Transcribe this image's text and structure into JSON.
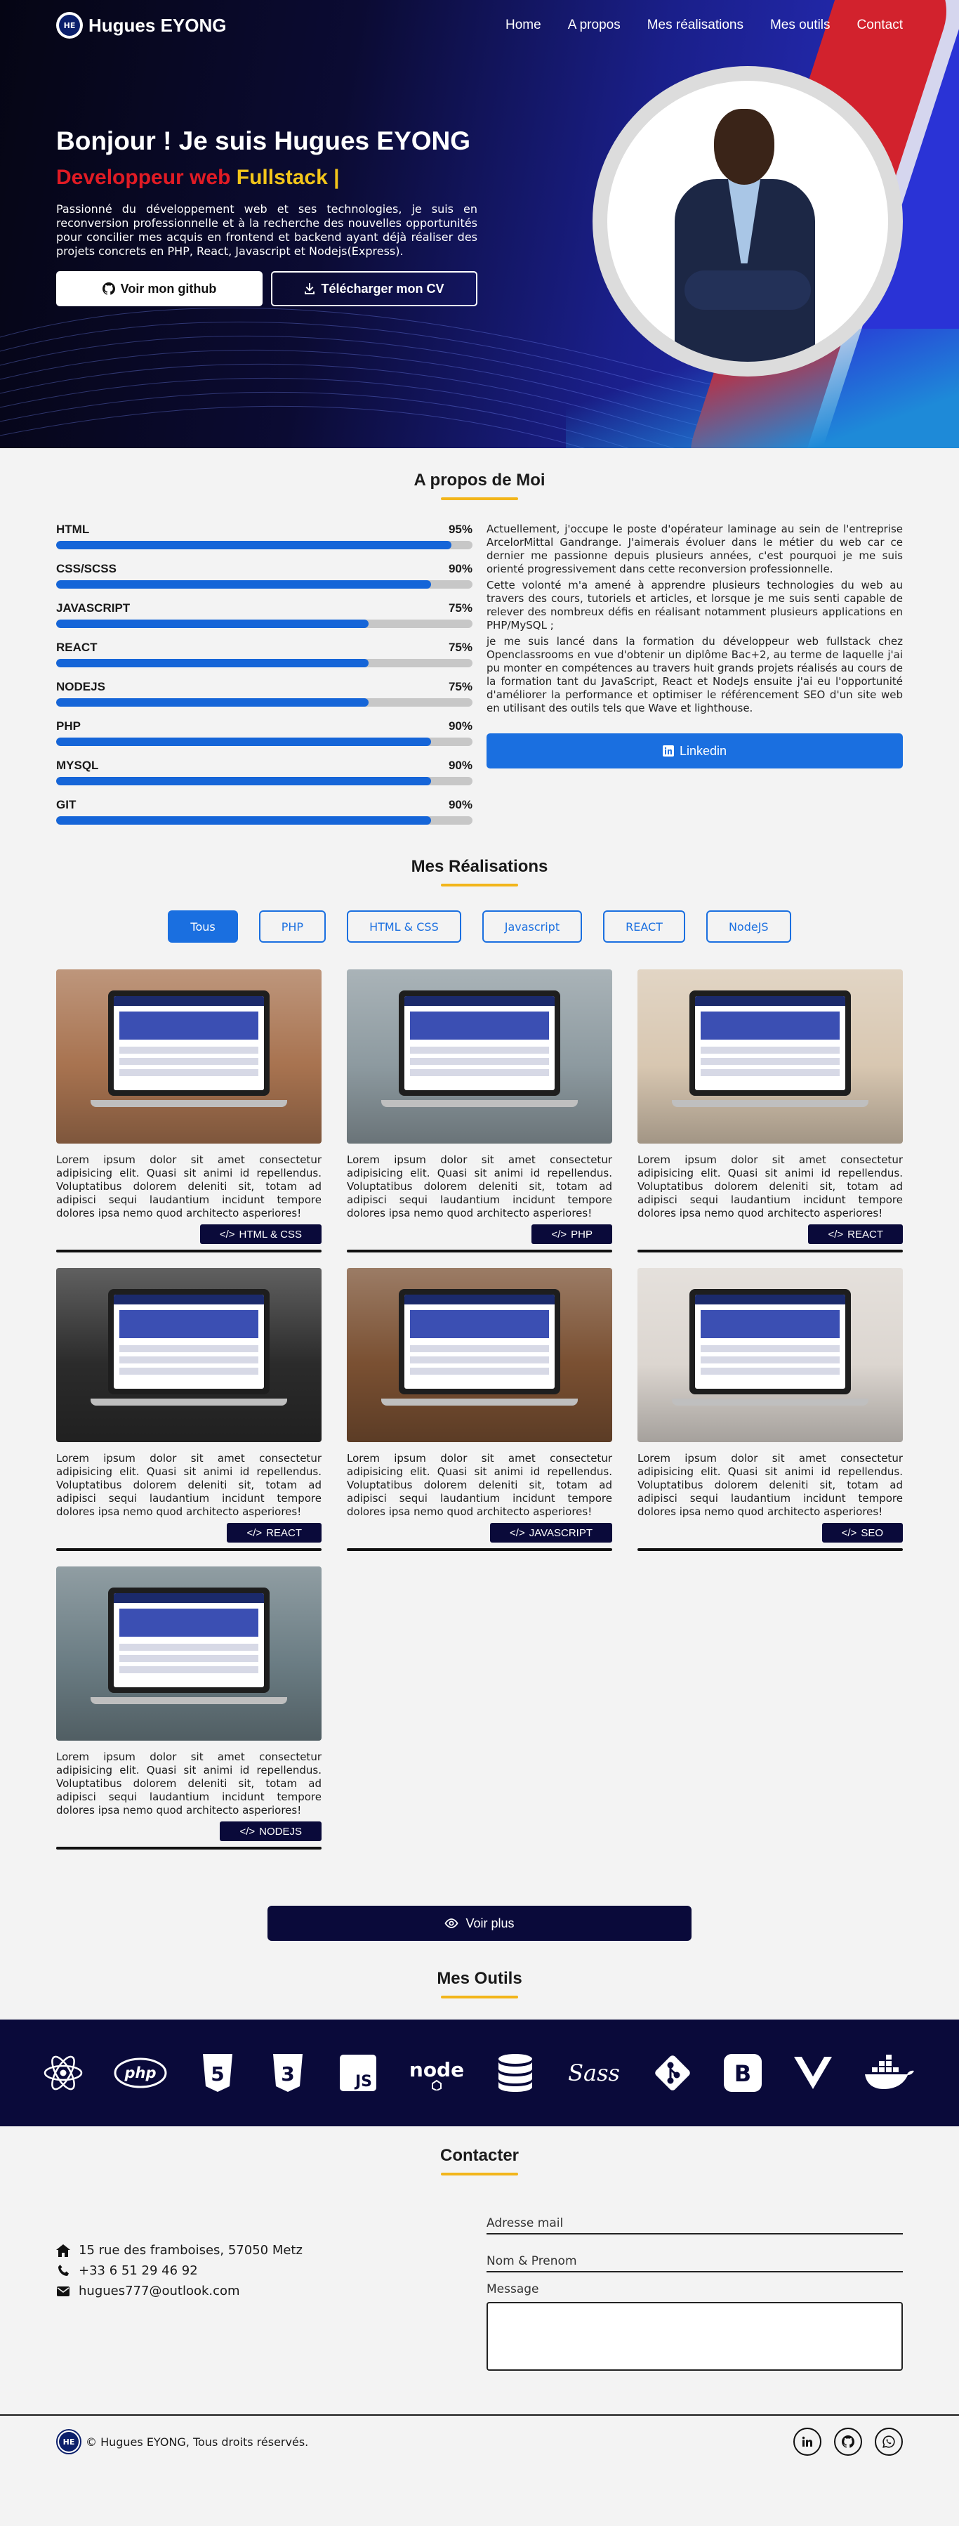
{
  "nav": {
    "brand": "Hugues EYONG",
    "items": [
      "Home",
      "A propos",
      "Mes réalisations",
      "Mes outils",
      "Contact"
    ]
  },
  "hero": {
    "title": "Bonjour ! Je suis Hugues EYONG",
    "subtitle_red": "Developpeur web",
    "subtitle_yellow": "Fullstack |",
    "description": "Passionné du développement web et ses technologies, je suis en reconversion professionnelle et à la recherche des nouvelles opportunités pour concilier mes acquis en frontend et backend ayant déjà réaliser des projets concrets en PHP, React, Javascript et Nodejs(Express).",
    "btn_github": "Voir mon github",
    "btn_cv": "Télécharger mon CV"
  },
  "about": {
    "title": "A propos de Moi",
    "skills": [
      {
        "name": "HTML",
        "percent_label": "95%",
        "level": 0.95
      },
      {
        "name": "CSS/SCSS",
        "percent_label": "90%",
        "level": 0.9
      },
      {
        "name": "JAVASCRIPT",
        "percent_label": "75%",
        "level": 0.75
      },
      {
        "name": "REACT",
        "percent_label": "75%",
        "level": 0.75
      },
      {
        "name": "NODEJS",
        "percent_label": "75%",
        "level": 0.75
      },
      {
        "name": "PHP",
        "percent_label": "90%",
        "level": 0.9
      },
      {
        "name": "MYSQL",
        "percent_label": "90%",
        "level": 0.9
      },
      {
        "name": "GIT",
        "percent_label": "90%",
        "level": 0.9
      }
    ],
    "paragraphs": [
      "Actuellement, j'occupe le poste d'opérateur laminage au sein de l'entreprise ArcelorMittal Gandrange. J'aimerais évoluer dans le métier du web car ce dernier me passionne depuis plusieurs années, c'est pourquoi je me suis orienté progressivement dans cette reconversion professionnelle.",
      "Cette volonté m'a amené à apprendre plusieurs technologies du web au travers des cours, tutoriels et articles, et lorsque je me suis senti capable de relever des nombreux défis en réalisant notamment plusieurs applications en PHP/MySQL ;",
      "je me suis lancé dans la formation du développeur web fullstack chez Openclassrooms en vue d'obtenir un diplôme Bac+2, au terme de laquelle j'ai pu monter en compétences au travers huit grands projets réalisés au cours de la formation tant du JavaScript, React et NodeJs ensuite j'ai eu l'opportunité d'améliorer la performance et optimiser le référencement SEO d'un site web en utilisant des outils tels que Wave et lighthouse."
    ],
    "btn_linkedin": "Linkedin"
  },
  "realisations": {
    "title": "Mes Réalisations",
    "filters": [
      "Tous",
      "PHP",
      "HTML & CSS",
      "Javascript",
      "REACT",
      "NodeJS"
    ],
    "active_filter": "Tous",
    "card_text": "Lorem ipsum dolor sit amet consectetur adipisicing elit. Quasi sit animi id repellendus. Voluptatibus dolorem deleniti sit, totam ad adipisci sequi laudantium incidunt tempore dolores ipsa nemo quod architecto asperiores!",
    "cards": [
      {
        "tag": "HTML & CSS",
        "bg": "#a87350"
      },
      {
        "tag": "PHP",
        "bg": "#8d9aa0"
      },
      {
        "tag": "REACT",
        "bg": "#d8c7b1"
      },
      {
        "tag": "REACT",
        "bg": "#2b2b2b"
      },
      {
        "tag": "JAVASCRIPT",
        "bg": "#7a5032"
      },
      {
        "tag": "SEO",
        "bg": "#dcd6d0"
      },
      {
        "tag": "NODEJS",
        "bg": "#6b7d84"
      }
    ],
    "btn_more": "Voir plus"
  },
  "tools": {
    "title": "Mes Outils",
    "icons": [
      "react-icon",
      "php-icon",
      "html5-icon",
      "css3-icon",
      "javascript-icon",
      "nodejs-icon",
      "database-icon",
      "sass-icon",
      "git-icon",
      "bootstrap-icon",
      "vue-icon",
      "docker-icon"
    ]
  },
  "contact": {
    "title": "Contacter",
    "address": "15 rue des framboises, 57050 Metz",
    "phone": "+33 6 51 29 46 92",
    "email": "hugues777@outlook.com",
    "field_email": "Adresse mail",
    "field_name": "Nom & Prenom",
    "field_message": "Message"
  },
  "footer": {
    "text": "© Hugues EYONG, Tous droits réservés."
  }
}
